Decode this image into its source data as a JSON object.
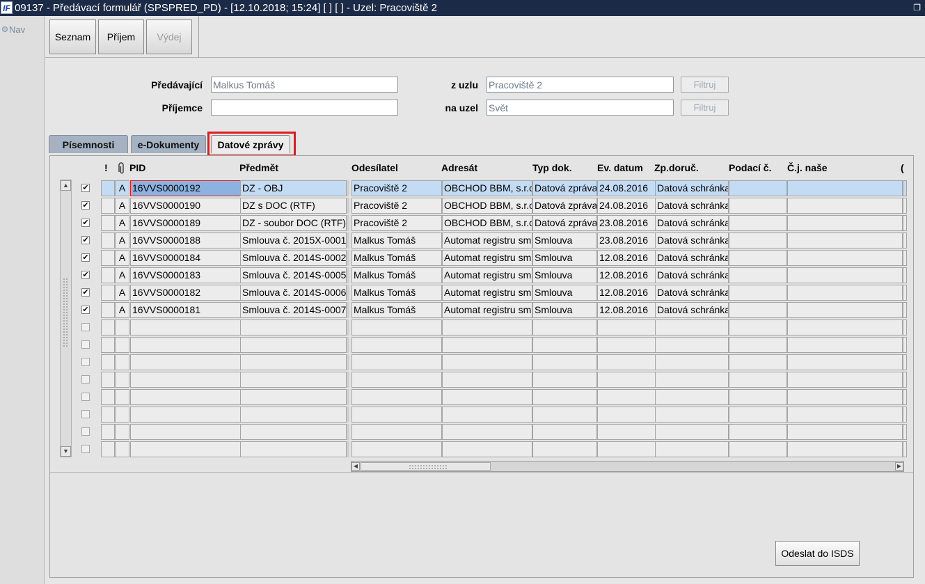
{
  "window": {
    "title": "09137 - Předávací formulář (SPSPRED_PD) - [12.10.2018; 15:24]  [ ]  [ ] - Uzel: Pracoviště 2",
    "icon_label": "IF"
  },
  "nav": {
    "label": "Nav"
  },
  "toolbar": {
    "seznam": "Seznam",
    "prijem": "Příjem",
    "vydej": "Výdej"
  },
  "form": {
    "predavajici_label": "Předávající",
    "predavajici_value": "Malkus Tomáš",
    "prijemce_label": "Příjemce",
    "prijemce_value": "",
    "z_uzlu_label": "z uzlu",
    "z_uzlu_value": "Pracoviště 2",
    "na_uzel_label": "na uzel",
    "na_uzel_value": "Svět",
    "filter_label": "Filtruj"
  },
  "tabs": [
    {
      "label": "Písemnosti",
      "active": false
    },
    {
      "label": "e-Dokumenty",
      "active": false
    },
    {
      "label": "Datové zprávy",
      "active": true
    }
  ],
  "table": {
    "columns": {
      "excl": "!",
      "pid": "PID",
      "predmet": "Předmět",
      "odesilatel": "Odesílatel",
      "adresat": "Adresát",
      "typ": "Typ dok.",
      "datum": "Ev. datum",
      "zpdoruc": "Zp.doruč.",
      "podaci": "Podací č.",
      "cj": "Č.j. naše",
      "more": "("
    },
    "rows": [
      {
        "checked": true,
        "a": "A",
        "pid": "16VVS0000192",
        "predmet": "DZ - OBJ",
        "odesilatel": "Pracoviště 2",
        "adresat": "OBCHOD BBM, s.r.o.",
        "typ": "Datová zpráva",
        "datum": "24.08.2016",
        "zpdoruc": "Datová schránka"
      },
      {
        "checked": true,
        "a": "A",
        "pid": "16VVS0000190",
        "predmet": "DZ s DOC (RTF)",
        "odesilatel": "Pracoviště 2",
        "adresat": "OBCHOD BBM, s.r.o.",
        "typ": "Datová zpráva",
        "datum": "24.08.2016",
        "zpdoruc": "Datová schránka"
      },
      {
        "checked": true,
        "a": "A",
        "pid": "16VVS0000189",
        "predmet": "DZ - soubor DOC (RTF)",
        "odesilatel": "Pracoviště 2",
        "adresat": "OBCHOD BBM, s.r.o.",
        "typ": "Datová zpráva",
        "datum": "23.08.2016",
        "zpdoruc": "Datová schránka"
      },
      {
        "checked": true,
        "a": "A",
        "pid": "16VVS0000188",
        "predmet": "Smlouva č. 2015X-0001",
        "odesilatel": "Malkus Tomáš",
        "adresat": "Automat registru smluv",
        "typ": "Smlouva",
        "datum": "23.08.2016",
        "zpdoruc": "Datová schránka"
      },
      {
        "checked": true,
        "a": "A",
        "pid": "16VVS0000184",
        "predmet": "Smlouva č. 2014S-0002",
        "odesilatel": "Malkus Tomáš",
        "adresat": "Automat registru smluv",
        "typ": "Smlouva",
        "datum": "12.08.2016",
        "zpdoruc": "Datová schránka"
      },
      {
        "checked": true,
        "a": "A",
        "pid": "16VVS0000183",
        "predmet": "Smlouva č. 2014S-0005",
        "odesilatel": "Malkus Tomáš",
        "adresat": "Automat registru smluv",
        "typ": "Smlouva",
        "datum": "12.08.2016",
        "zpdoruc": "Datová schránka"
      },
      {
        "checked": true,
        "a": "A",
        "pid": "16VVS0000182",
        "predmet": "Smlouva č. 2014S-0006",
        "odesilatel": "Malkus Tomáš",
        "adresat": "Automat registru smluv",
        "typ": "Smlouva",
        "datum": "12.08.2016",
        "zpdoruc": "Datová schránka"
      },
      {
        "checked": true,
        "a": "A",
        "pid": "16VVS0000181",
        "predmet": "Smlouva č. 2014S-0007",
        "odesilatel": "Malkus Tomáš",
        "adresat": "Automat registru smluv",
        "typ": "Smlouva",
        "datum": "12.08.2016",
        "zpdoruc": "Datová schránka"
      },
      {
        "checked": false,
        "a": "",
        "pid": "",
        "predmet": "",
        "odesilatel": "",
        "adresat": "",
        "typ": "",
        "datum": "",
        "zpdoruc": ""
      },
      {
        "checked": false,
        "a": "",
        "pid": "",
        "predmet": "",
        "odesilatel": "",
        "adresat": "",
        "typ": "",
        "datum": "",
        "zpdoruc": ""
      },
      {
        "checked": false,
        "a": "",
        "pid": "",
        "predmet": "",
        "odesilatel": "",
        "adresat": "",
        "typ": "",
        "datum": "",
        "zpdoruc": ""
      },
      {
        "checked": false,
        "a": "",
        "pid": "",
        "predmet": "",
        "odesilatel": "",
        "adresat": "",
        "typ": "",
        "datum": "",
        "zpdoruc": ""
      },
      {
        "checked": false,
        "a": "",
        "pid": "",
        "predmet": "",
        "odesilatel": "",
        "adresat": "",
        "typ": "",
        "datum": "",
        "zpdoruc": ""
      },
      {
        "checked": false,
        "a": "",
        "pid": "",
        "predmet": "",
        "odesilatel": "",
        "adresat": "",
        "typ": "",
        "datum": "",
        "zpdoruc": ""
      },
      {
        "checked": false,
        "a": "",
        "pid": "",
        "predmet": "",
        "odesilatel": "",
        "adresat": "",
        "typ": "",
        "datum": "",
        "zpdoruc": ""
      },
      {
        "checked": false,
        "a": "",
        "pid": "",
        "predmet": "",
        "odesilatel": "",
        "adresat": "",
        "typ": "",
        "datum": "",
        "zpdoruc": ""
      }
    ]
  },
  "actions": {
    "send": "Odeslat do ISDS"
  }
}
